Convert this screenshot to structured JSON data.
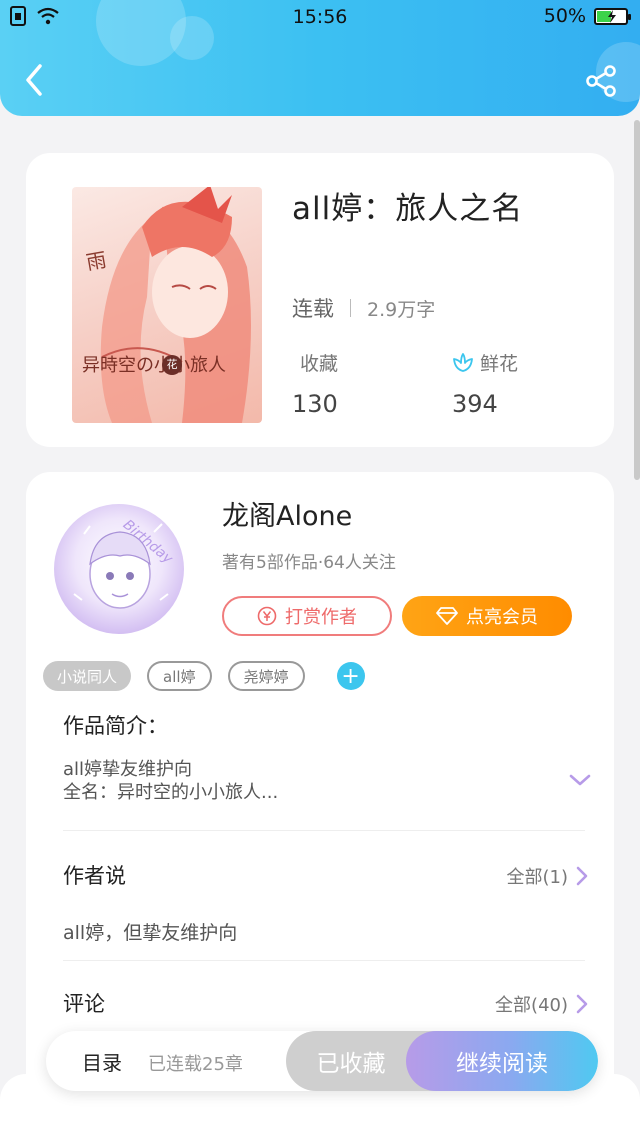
{
  "status_bar": {
    "time": "15:56",
    "battery": "50%",
    "battery_level": 0.5
  },
  "book": {
    "title": "all婷：旅人之名",
    "status": "连载",
    "word_count": "2.9万字",
    "stats": [
      {
        "label": "收藏",
        "value": "130"
      },
      {
        "label": "鲜花",
        "value": "394"
      }
    ],
    "cover_text": {
      "top": "雨",
      "main": "异時空の小小旅人",
      "seal": "花"
    }
  },
  "author": {
    "name": "龙阁Alone",
    "info": "著有5部作品·64人关注",
    "avatar_text": "Birthday",
    "tip_button": "打赏作者",
    "vip_button": "点亮会员",
    "tags": [
      "小说同人",
      "all婷",
      "尧婷婷"
    ]
  },
  "intro": {
    "title": "作品简介：",
    "lines": [
      "all婷挚友维护向",
      "全名：异时空的小小旅人..."
    ]
  },
  "author_says": {
    "title": "作者说",
    "more": "全部(1)",
    "text": "all婷，但挚友维护向"
  },
  "comments": {
    "title": "评论",
    "more": "全部(40)"
  },
  "bottom_bar": {
    "toc": "目录",
    "chapters": "已连载25章",
    "collected": "已收藏",
    "continue": "继续阅读"
  },
  "colors": {
    "header_start": "#5ad0f4",
    "header_end": "#33aef1",
    "vip_orange": "#ff9a0a",
    "tip_red": "#ee6a6a",
    "accent_blue": "#3cc6ee"
  }
}
